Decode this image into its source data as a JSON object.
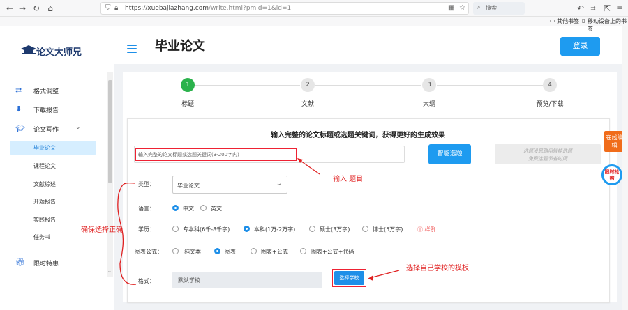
{
  "browser": {
    "url_host": "https://xuebajiazhang.com",
    "url_path": "/write.html?pmid=1&id=1",
    "search_placeholder": "搜索",
    "bookmarks": [
      "其他书签",
      "移动设备上的书签"
    ]
  },
  "sidebar": {
    "logo_text": "论文大师兄",
    "items": [
      {
        "label": "格式调整",
        "icon": "swap-arrows-icon"
      },
      {
        "label": "下载报告",
        "icon": "download-icon"
      },
      {
        "label": "论文写作",
        "icon": "graduation-cap-icon"
      }
    ],
    "subitems": [
      "毕业论文",
      "课程论文",
      "文献综述",
      "开题报告",
      "实践报告",
      "任务书"
    ],
    "active_subitem": "毕业论文",
    "promo": {
      "label": "限时特惠",
      "icon": "gift-icon"
    }
  },
  "header": {
    "title": "毕业论文",
    "login_label": "登录"
  },
  "steps": [
    {
      "number": "1",
      "label": "标题",
      "active": true
    },
    {
      "number": "2",
      "label": "文献",
      "active": false
    },
    {
      "number": "3",
      "label": "大纲",
      "active": false
    },
    {
      "number": "4",
      "label": "预览/下载",
      "active": false
    }
  ],
  "form": {
    "heading": "输入完整的论文标题或选题关键词，获得更好的生成效果",
    "title_placeholder": "输入完整的论文标题或选题关键词(3-200字内)",
    "smart_button": "智能选题",
    "tip_line1": "选题没思路用智能选题",
    "tip_line2": "免费选题节省时间",
    "type_label": "类型：",
    "type_value": "毕业论文",
    "language_label": "语言：",
    "language_options": [
      "中文",
      "英文"
    ],
    "language_selected": "中文",
    "degree_label": "学历：",
    "degree_options": [
      "专本科(6千-8千字)",
      "本科(1万-2万字)",
      "硕士(3万字)",
      "博士(5万字)"
    ],
    "degree_selected": "本科(1万-2万字)",
    "sample_label": "样例",
    "chart_label": "图表公式：",
    "chart_options": [
      "纯文本",
      "图表",
      "图表+公式",
      "图表+公式+代码"
    ],
    "chart_selected": "图表",
    "format_label": "格式：",
    "format_value": "默认学校",
    "choose_school_button": "选择学校"
  },
  "annotations": {
    "input_topic": "输入 题目",
    "ensure_correct": "确保选择正确",
    "choose_template": "选择自己学校的模板"
  },
  "floating": {
    "online_edit": "在线编辑",
    "limited_offer": "限时抢购"
  },
  "colors": {
    "primary_blue": "#1e9bf0",
    "step_green": "#2bb24c",
    "annotation_red": "#e02020",
    "float_orange": "#f06c1a"
  }
}
